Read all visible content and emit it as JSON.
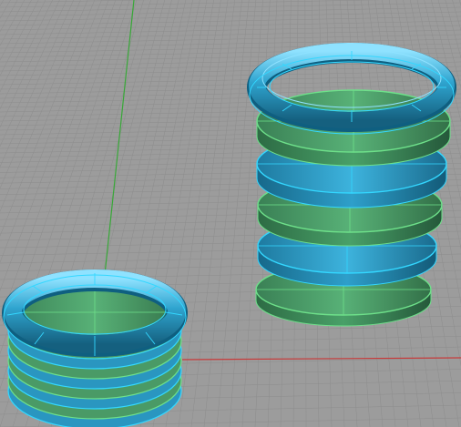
{
  "viewport": {
    "view": "perspective",
    "display_mode": "shaded",
    "background_color": "#9c9c9c",
    "grid_color": "#8d8d8d",
    "x_axis_color": "#c83a3a",
    "y_axis_color": "#38a838"
  },
  "objects": [
    {
      "name": "tall-disk-stack",
      "disks": [
        {
          "role": "bottom-disk",
          "state": "unselected"
        },
        {
          "role": "disk",
          "state": "selected"
        },
        {
          "role": "disk",
          "state": "unselected"
        },
        {
          "role": "disk",
          "state": "selected"
        },
        {
          "role": "top-disk",
          "state": "unselected"
        }
      ],
      "ring": {
        "shape": "torus",
        "state": "selected"
      }
    },
    {
      "name": "short-disk-stack",
      "layers": 8,
      "ring": {
        "shape": "torus",
        "state": "selected"
      }
    }
  ],
  "colors": {
    "unselected_fill": "#4a9a66",
    "unselected_edge": "#6ee08a",
    "selected_fill": "#2a96c0",
    "selected_edge": "#33d7ff",
    "ring_fill": "#2c9cc6",
    "ring_highlight": "#8fe2ff"
  }
}
